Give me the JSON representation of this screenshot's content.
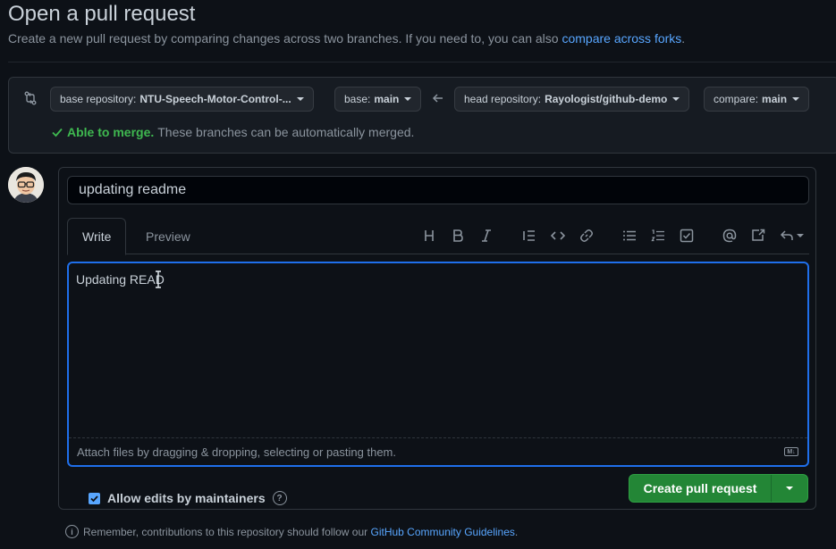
{
  "header": {
    "title": "Open a pull request",
    "subtitle": "Create a new pull request by comparing changes across two branches. If you need to, you can also",
    "subtitle_link": "compare across forks",
    "subtitle_end": "."
  },
  "branches": {
    "base_repo_label": "base repository:",
    "base_repo_value": "NTU-Speech-Motor-Control-...",
    "base_label": "base:",
    "base_value": "main",
    "head_repo_label": "head repository:",
    "head_repo_value": "Rayologist/github-demo",
    "compare_label": "compare:",
    "compare_value": "main"
  },
  "merge": {
    "status": "Able to merge.",
    "detail": "These branches can be automatically merged."
  },
  "form": {
    "title_value": "updating readme",
    "tabs": [
      {
        "label": "Write"
      },
      {
        "label": "Preview"
      }
    ],
    "toolbar": [
      "heading-icon",
      "bold-icon",
      "italic-icon",
      "quote-icon",
      "code-icon",
      "link-icon",
      "unordered-list-icon",
      "ordered-list-icon",
      "task-list-icon",
      "mention-icon",
      "reference-icon",
      "reply-icon"
    ],
    "body_value": "Updating READ",
    "attach_text": "Attach files by dragging & dropping, selecting or pasting them.",
    "allow_edits_label": "Allow edits by maintainers",
    "allow_edits_checked": true,
    "create_button": "Create pull request"
  },
  "footer": {
    "text": "Remember, contributions to this repository should follow our",
    "link": "GitHub Community Guidelines",
    "end": "."
  },
  "colors": {
    "accent": "#58a6ff",
    "success": "#3fb950",
    "primary_button": "#238636",
    "focus_border": "#1f6feb"
  }
}
